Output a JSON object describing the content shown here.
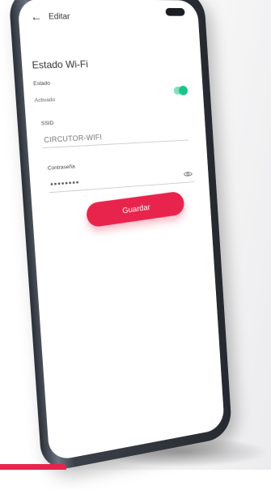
{
  "header": {
    "title": "Editar"
  },
  "section": {
    "title": "Estado Wi-Fi"
  },
  "status": {
    "label": "Estado",
    "value": "Activado",
    "enabled": true
  },
  "ssid": {
    "label": "SSID",
    "value": "CIRCUTOR-WIFI"
  },
  "password": {
    "label": "Contraseña",
    "value": "••••••••"
  },
  "actions": {
    "save_label": "Guardar"
  },
  "colors": {
    "accent": "#e8244c",
    "toggle_on": "#19c489"
  },
  "icons": {
    "back": "arrow-left-icon",
    "visibility": "eye-icon"
  }
}
